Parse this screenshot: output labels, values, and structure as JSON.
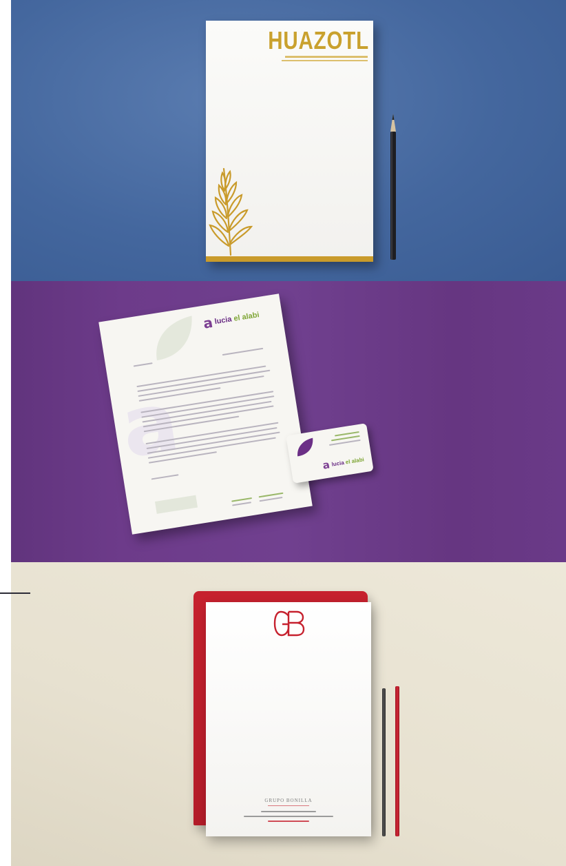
{
  "panels": [
    {
      "id": "huazotl",
      "background_color": "#4a6ca3",
      "brand": "HUAZOTL",
      "accent_color": "#c9a12e"
    },
    {
      "id": "lucia-el-alabi",
      "background_color": "#6a3a88",
      "brand_name": "lucia el alabi",
      "brand_parts": {
        "first": "lucia",
        "second": "el alabi"
      },
      "accent_color": "#7fa636"
    },
    {
      "id": "grupo-bonilla",
      "background_color": "#e8e2d2",
      "monogram": "GB",
      "footer_name": "GRUPO BONILLA",
      "accent_color": "#c6212e"
    }
  ],
  "icons": [
    "pencil-icon",
    "wheat-plant-icon",
    "leaf-icon",
    "pen-icon"
  ]
}
